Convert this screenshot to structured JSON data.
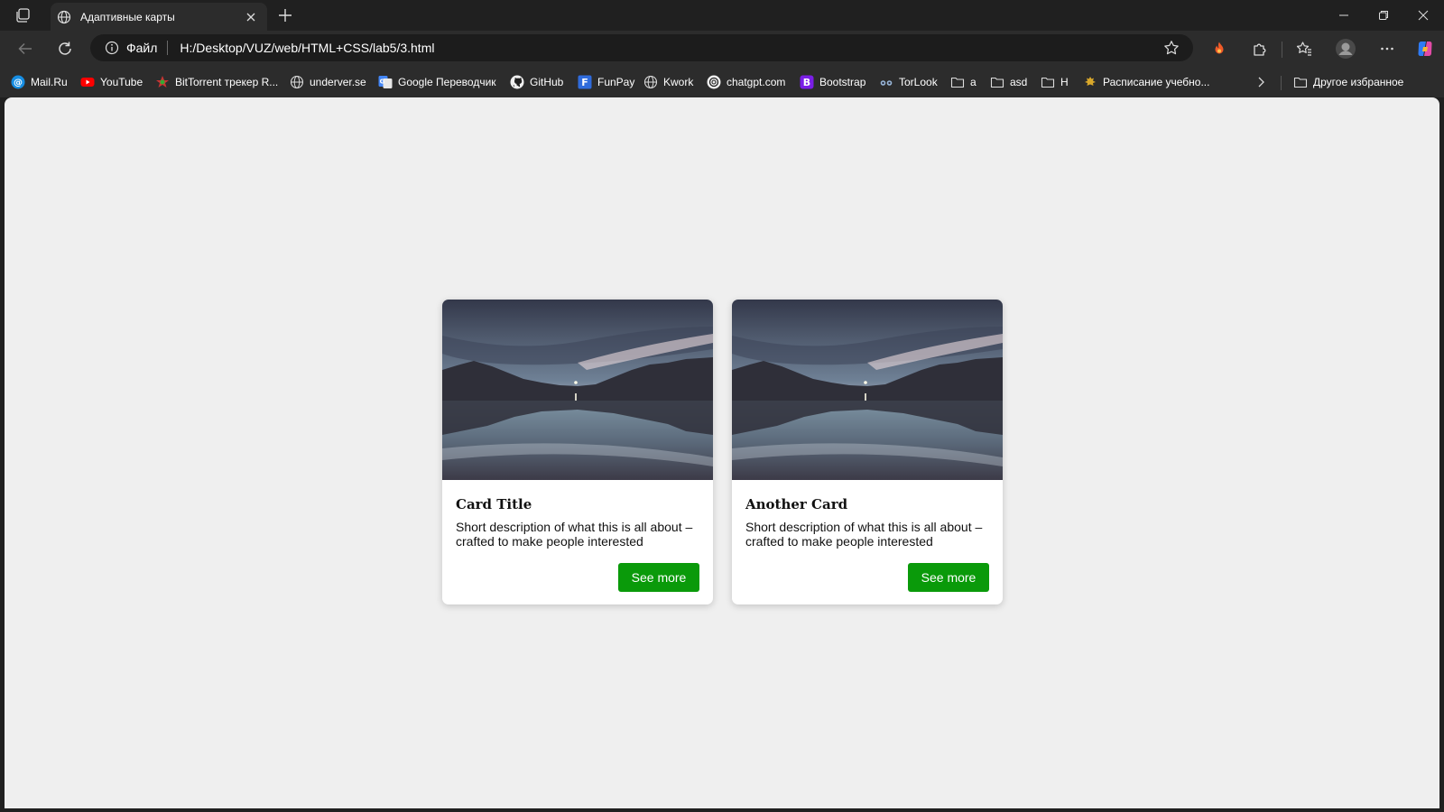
{
  "browser": {
    "tab": {
      "title": "Адаптивные карты"
    },
    "address": {
      "scheme_label": "Файл",
      "url": "H:/Desktop/VUZ/web/HTML+CSS/lab5/3.html"
    },
    "bookmarks": [
      {
        "label": "Mail.Ru",
        "icon": "mailru-icon"
      },
      {
        "label": "YouTube",
        "icon": "youtube-icon"
      },
      {
        "label": "BitTorrent трекер R...",
        "icon": "bittorrent-icon"
      },
      {
        "label": "underver.se",
        "icon": "globe-icon"
      },
      {
        "label": "Google Переводчик",
        "icon": "google-translate-icon"
      },
      {
        "label": "GitHub",
        "icon": "github-icon"
      },
      {
        "label": "FunPay",
        "icon": "funpay-icon"
      },
      {
        "label": "Kwork",
        "icon": "globe-icon"
      },
      {
        "label": "chatgpt.com",
        "icon": "chatgpt-icon"
      },
      {
        "label": "Bootstrap",
        "icon": "bootstrap-icon"
      },
      {
        "label": "TorLook",
        "icon": "torlook-icon"
      },
      {
        "label": "a",
        "icon": "folder-icon"
      },
      {
        "label": "asd",
        "icon": "folder-icon"
      },
      {
        "label": "Н",
        "icon": "folder-icon"
      },
      {
        "label": "Расписание учебно...",
        "icon": "emblem-icon"
      }
    ],
    "other_bookmarks": "Другое избранное"
  },
  "cards": [
    {
      "title": "Card Title",
      "description": "Short description of what this is all about – crafted to make people interested",
      "button": "See more"
    },
    {
      "title": "Another Card",
      "description": "Short description of what this is all about – crafted to make people interested",
      "button": "See more"
    }
  ],
  "colors": {
    "accent_button": "#0a9a0a",
    "page_bg": "#efefef",
    "chrome_bg": "#2c2c2c"
  }
}
